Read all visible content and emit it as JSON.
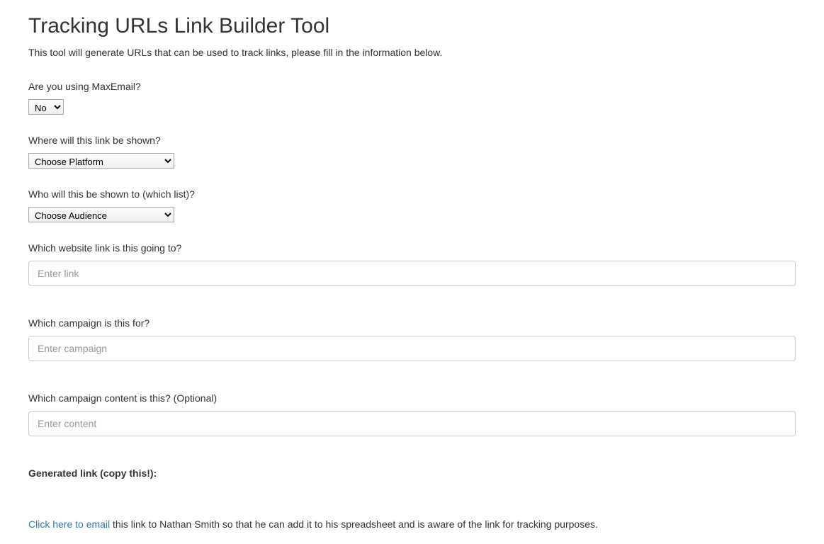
{
  "header": {
    "title": "Tracking URLs Link Builder Tool",
    "subtitle": "This tool will generate URLs that can be used to track links, please fill in the information below."
  },
  "form": {
    "maxemail": {
      "label": "Are you using MaxEmail?",
      "selected": "No"
    },
    "platform": {
      "label": "Where will this link be shown?",
      "selected": "Choose Platform"
    },
    "audience": {
      "label": "Who will this be shown to (which list)?",
      "selected": "Choose Audience"
    },
    "link": {
      "label": "Which website link is this going to?",
      "placeholder": "Enter link",
      "value": ""
    },
    "campaign": {
      "label": "Which campaign is this for?",
      "placeholder": "Enter campaign",
      "value": ""
    },
    "content": {
      "label": "Which campaign content is this? (Optional)",
      "placeholder": "Enter content",
      "value": ""
    }
  },
  "generated": {
    "label": "Generated link (copy this!):"
  },
  "email": {
    "link_text": "Click here to email",
    "rest_text": " this link to Nathan Smith so that he can add it to his spreadsheet and is aware of the link for tracking purposes."
  }
}
